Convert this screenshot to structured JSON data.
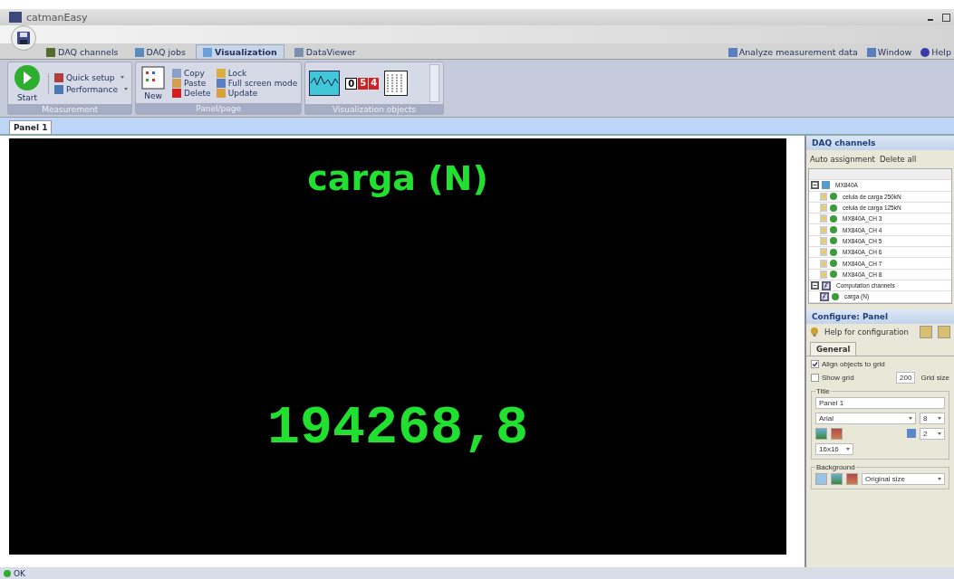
{
  "window": {
    "title": "catmanEasy"
  },
  "tabs": [
    {
      "label": "DAQ channels",
      "selected": false
    },
    {
      "label": "DAQ jobs",
      "selected": false
    },
    {
      "label": "Visualization",
      "selected": true
    },
    {
      "label": "DataViewer",
      "selected": false
    }
  ],
  "right_menu": [
    "Analyze measurement data",
    "Window",
    "Help"
  ],
  "ribbon": {
    "start": "Start",
    "quick_setup": "Quick setup",
    "performance": "Performance",
    "measurement_group": "Measurement",
    "new": "New",
    "panel_items": [
      "Copy",
      "Lock",
      "Paste",
      "Full screen mode",
      "Delete",
      "Update"
    ],
    "panel_group": "Panel/page",
    "objects_group": "Visualization objects",
    "digits": [
      "0",
      "5",
      "4"
    ]
  },
  "page_tabs": [
    {
      "label": "Panel 1",
      "selected": true
    }
  ],
  "display": {
    "title": "carga (N)",
    "value": "194268,8"
  },
  "daq_panel": {
    "title": "DAQ channels",
    "actions": [
      "Auto assignment",
      "Delete all"
    ],
    "groups": [
      {
        "name": "MX840A",
        "expanded": true,
        "kind": "device",
        "children": [
          "celula de carga 250kN",
          "celula de carga 125kN",
          "MX840A_CH 3",
          "MX840A_CH 4",
          "MX840A_CH 5",
          "MX840A_CH 6",
          "MX840A_CH 7",
          "MX840A_CH 8"
        ]
      },
      {
        "name": "Computation channels",
        "expanded": true,
        "kind": "computation",
        "children": [
          "carga (N)"
        ]
      }
    ]
  },
  "config_panel": {
    "title": "Configure: Panel",
    "help": "Help for configuration",
    "tab": "General",
    "align_to_grid": {
      "label": "Align objects to grid",
      "checked": true
    },
    "show_grid": {
      "label": "Show grid",
      "checked": false
    },
    "grid_size": "200",
    "grid_size_label": "Grid size",
    "title_group": "Title",
    "title_value": "Panel 1",
    "font": "Arial",
    "font_size": "8",
    "spacing": "2",
    "icon_size": "16x16",
    "background_group": "Background",
    "background_mode": "Original size"
  },
  "status_bar": {
    "text": "OK"
  }
}
